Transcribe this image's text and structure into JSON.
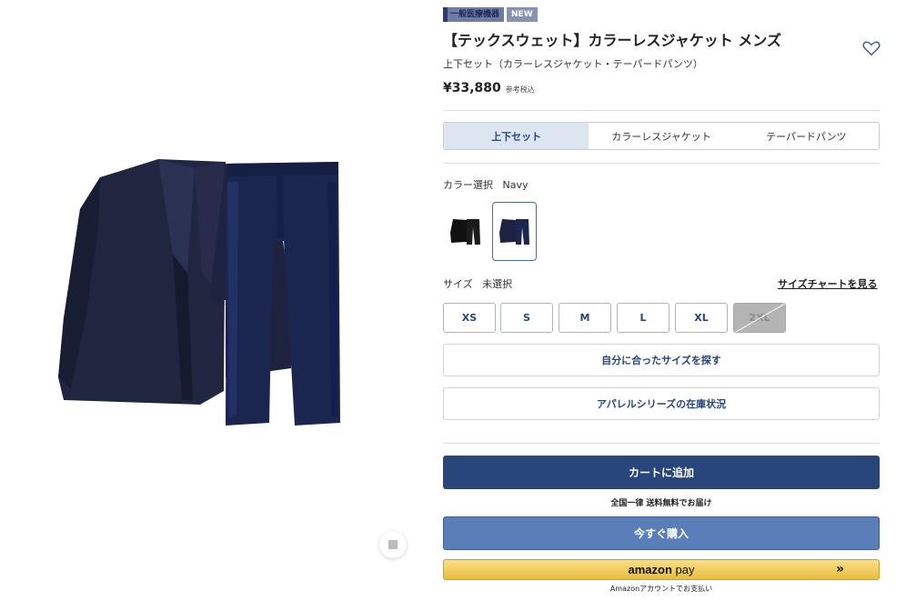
{
  "badges": {
    "medical": "一般医療機器",
    "new": "NEW"
  },
  "product": {
    "title": "【テックスウェット】カラーレスジャケット メンズ",
    "subtitle": "上下セット（カラーレスジャケット・テーパードパンツ）",
    "price": "¥33,880",
    "tax_note": "参考税込"
  },
  "tabs": [
    {
      "label": "上下セット",
      "active": true
    },
    {
      "label": "カラーレスジャケット",
      "active": false
    },
    {
      "label": "テーパードパンツ",
      "active": false
    }
  ],
  "color": {
    "label": "カラー選択",
    "selected": "Navy",
    "options": [
      "Black",
      "Navy"
    ]
  },
  "size": {
    "label": "サイズ",
    "status": "未選択",
    "chart_link": "サイズチャートを見る",
    "options": [
      {
        "label": "XS",
        "available": true
      },
      {
        "label": "S",
        "available": true
      },
      {
        "label": "M",
        "available": true
      },
      {
        "label": "L",
        "available": true
      },
      {
        "label": "XL",
        "available": true
      },
      {
        "label": "2XL",
        "available": false
      }
    ]
  },
  "buttons": {
    "find_size": "自分に合ったサイズを探す",
    "stock": "アパレルシリーズの在庫状況",
    "add_to_cart": "カートに追加",
    "shipping_note": "全国一律 送料無料でお届け",
    "buy_now": "今すぐ購入",
    "amazon_pay_brand": "amazon",
    "amazon_pay_suffix": "pay",
    "amazon_arrow": "»",
    "amazon_note": "Amazonアカウントでお支払い"
  },
  "colors": {
    "brand_navy": "#29467a",
    "buy_blue": "#5a7fb8",
    "amazon_yellow": "#f0cd5a"
  }
}
